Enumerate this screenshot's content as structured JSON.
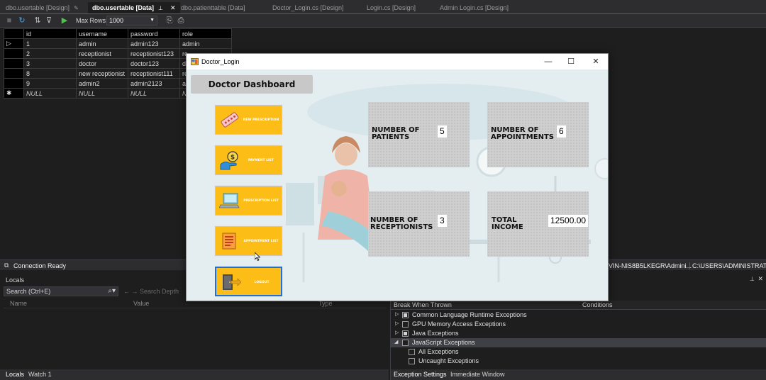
{
  "tabs": [
    {
      "label": "dbo.usertable [Design]",
      "active": false
    },
    {
      "label": "dbo.usertable [Data]",
      "active": true
    },
    {
      "label": "dbo.patienttable [Data]",
      "active": false
    },
    {
      "label": "Doctor_Login.cs [Design]",
      "active": false
    },
    {
      "label": "Login.cs [Design]",
      "active": false
    },
    {
      "label": "Admin Login.cs [Design]",
      "active": false
    }
  ],
  "toolbar": {
    "max_rows_label": "Max Rows:",
    "max_rows_value": "1000",
    "icons": [
      "refresh-icon",
      "filter-icon",
      "execute-icon",
      "script-icon"
    ]
  },
  "grid": {
    "columns": [
      "id",
      "username",
      "password",
      "role"
    ],
    "rows": [
      {
        "marker": "arrow",
        "id": "1",
        "username": "admin",
        "password": "admin123",
        "role": "admin"
      },
      {
        "marker": "",
        "id": "2",
        "username": "receptionist",
        "password": "receptionist123",
        "role": "re"
      },
      {
        "marker": "",
        "id": "3",
        "username": "doctor",
        "password": "doctor123",
        "role": "d"
      },
      {
        "marker": "",
        "id": "8",
        "username": "new receptionist",
        "password": "receptionist111",
        "role": "re"
      },
      {
        "marker": "",
        "id": "9",
        "username": "admin2",
        "password": "admin2123",
        "role": "a"
      },
      {
        "marker": "new",
        "id": "NULL",
        "username": "NULL",
        "password": "NULL",
        "role": "N"
      }
    ]
  },
  "status": {
    "connection": "Connection Ready",
    "server": "VIN-NIS8B5LKEGR\\Admini...",
    "path": "C:\\USERS\\ADMINISTRATOR..."
  },
  "locals": {
    "title": "Locals",
    "search_placeholder": "Search (Ctrl+E)",
    "search_depth": "Search Depth",
    "columns": [
      "Name",
      "Value",
      "Type"
    ],
    "bottom_tabs": [
      "Locals",
      "Watch 1"
    ]
  },
  "exceptions": {
    "columns": [
      "Break When Thrown",
      "Conditions"
    ],
    "rows": [
      {
        "label": "Common Language Runtime Exceptions",
        "level": 0,
        "state": "filled",
        "expand": "collapsed"
      },
      {
        "label": "GPU Memory Access Exceptions",
        "level": 0,
        "state": "empty",
        "expand": "collapsed"
      },
      {
        "label": "Java Exceptions",
        "level": 0,
        "state": "filled",
        "expand": "collapsed"
      },
      {
        "label": "JavaScript Exceptions",
        "level": 0,
        "state": "empty",
        "expand": "expanded",
        "selected": true
      },
      {
        "label": "All Exceptions",
        "level": 1,
        "state": "empty"
      },
      {
        "label": "Uncaught Exceptions",
        "level": 1,
        "state": "empty"
      }
    ],
    "bottom_tabs": [
      "Exception Settings",
      "Immediate Window"
    ]
  },
  "window": {
    "title": "Doctor_Login",
    "minimize": "—",
    "maximize": "☐",
    "close": "✕"
  },
  "dashboard": {
    "title": "Doctor Dashboard",
    "nav": [
      {
        "label": "NEW PRESCRIPTION",
        "icon": "pills-icon"
      },
      {
        "label": "PAYMENT LIST",
        "icon": "payment-icon"
      },
      {
        "label": "PRESCRIPTION LIST",
        "icon": "laptop-icon"
      },
      {
        "label": "APPOINTMENT LIST",
        "icon": "clipboard-icon"
      },
      {
        "label": "LOGOUT",
        "icon": "logout-door-icon"
      }
    ],
    "stats": [
      {
        "label": "NUMBER OF\nPATIENTS",
        "value": "5"
      },
      {
        "label": "NUMBER OF\nAPPOINTMENTS",
        "value": "6"
      },
      {
        "label": "NUMBER OF\nRECEPTIONISTS",
        "value": "3"
      },
      {
        "label": "TOTAL\nINCOME",
        "value": "12500.00"
      }
    ]
  },
  "colors": {
    "accent": "#007acc",
    "nav_button": "#fbbd16",
    "active_border": "#1f6fd6",
    "stat_card": "#cfcfcf"
  }
}
